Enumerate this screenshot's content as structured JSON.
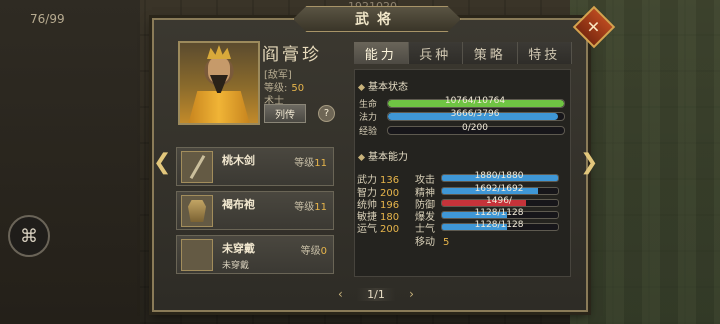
{
  "hud": {
    "counter": "76/99",
    "top_number": "1921020"
  },
  "window": {
    "title": "武将"
  },
  "general": {
    "name": "阎膏珍",
    "faction": "[敌军]",
    "level_label": "等级:",
    "level_value": "50",
    "class": "术士",
    "biography_button": "列传",
    "help_button": "?"
  },
  "tabs": [
    {
      "label": "能力",
      "active": true
    },
    {
      "label": "兵种",
      "active": false
    },
    {
      "label": "策略",
      "active": false
    },
    {
      "label": "特技",
      "active": false
    }
  ],
  "equipment": [
    {
      "name": "桃木剑",
      "level_label": "等级",
      "level": "11",
      "sub": ""
    },
    {
      "name": "褐布袍",
      "level_label": "等级",
      "level": "11",
      "sub": ""
    },
    {
      "name": "未穿戴",
      "level_label": "等级",
      "level": "0",
      "sub": "未穿戴"
    }
  ],
  "basic_status": {
    "title": "基本状态",
    "rows": [
      {
        "label": "生命",
        "text": "10764/10764",
        "fraction": 1.0,
        "color": "#6fc443"
      },
      {
        "label": "法力",
        "text": "3666/3796",
        "fraction": 0.966,
        "color": "#3f97d6"
      },
      {
        "label": "经验",
        "text": "0/200",
        "fraction": 0.0,
        "color": "#c9b37b"
      }
    ]
  },
  "basic_ability": {
    "title": "基本能力",
    "stats": [
      {
        "label": "武力",
        "value": "136"
      },
      {
        "label": "智力",
        "value": "200"
      },
      {
        "label": "统帅",
        "value": "196"
      },
      {
        "label": "敏捷",
        "value": "180"
      },
      {
        "label": "运气",
        "value": "200"
      }
    ],
    "bars": [
      {
        "label": "攻击",
        "text": "1880/1880",
        "fraction": 1.0,
        "color": "#3f97d6"
      },
      {
        "label": "精神",
        "text": "1692/1692",
        "fraction": 0.83,
        "color": "#3f97d6"
      },
      {
        "label": "防御",
        "text": "1496/",
        "fraction": 0.72,
        "color": "#c6333a"
      },
      {
        "label": "爆发",
        "text": "1128/1128",
        "fraction": 0.56,
        "color": "#3f97d6"
      },
      {
        "label": "士气",
        "text": "1128/1128",
        "fraction": 0.56,
        "color": "#3f97d6"
      }
    ],
    "move_label": "移动",
    "move_value": "5"
  },
  "pager": {
    "prev": "‹",
    "text": "1/1",
    "next": "›"
  }
}
